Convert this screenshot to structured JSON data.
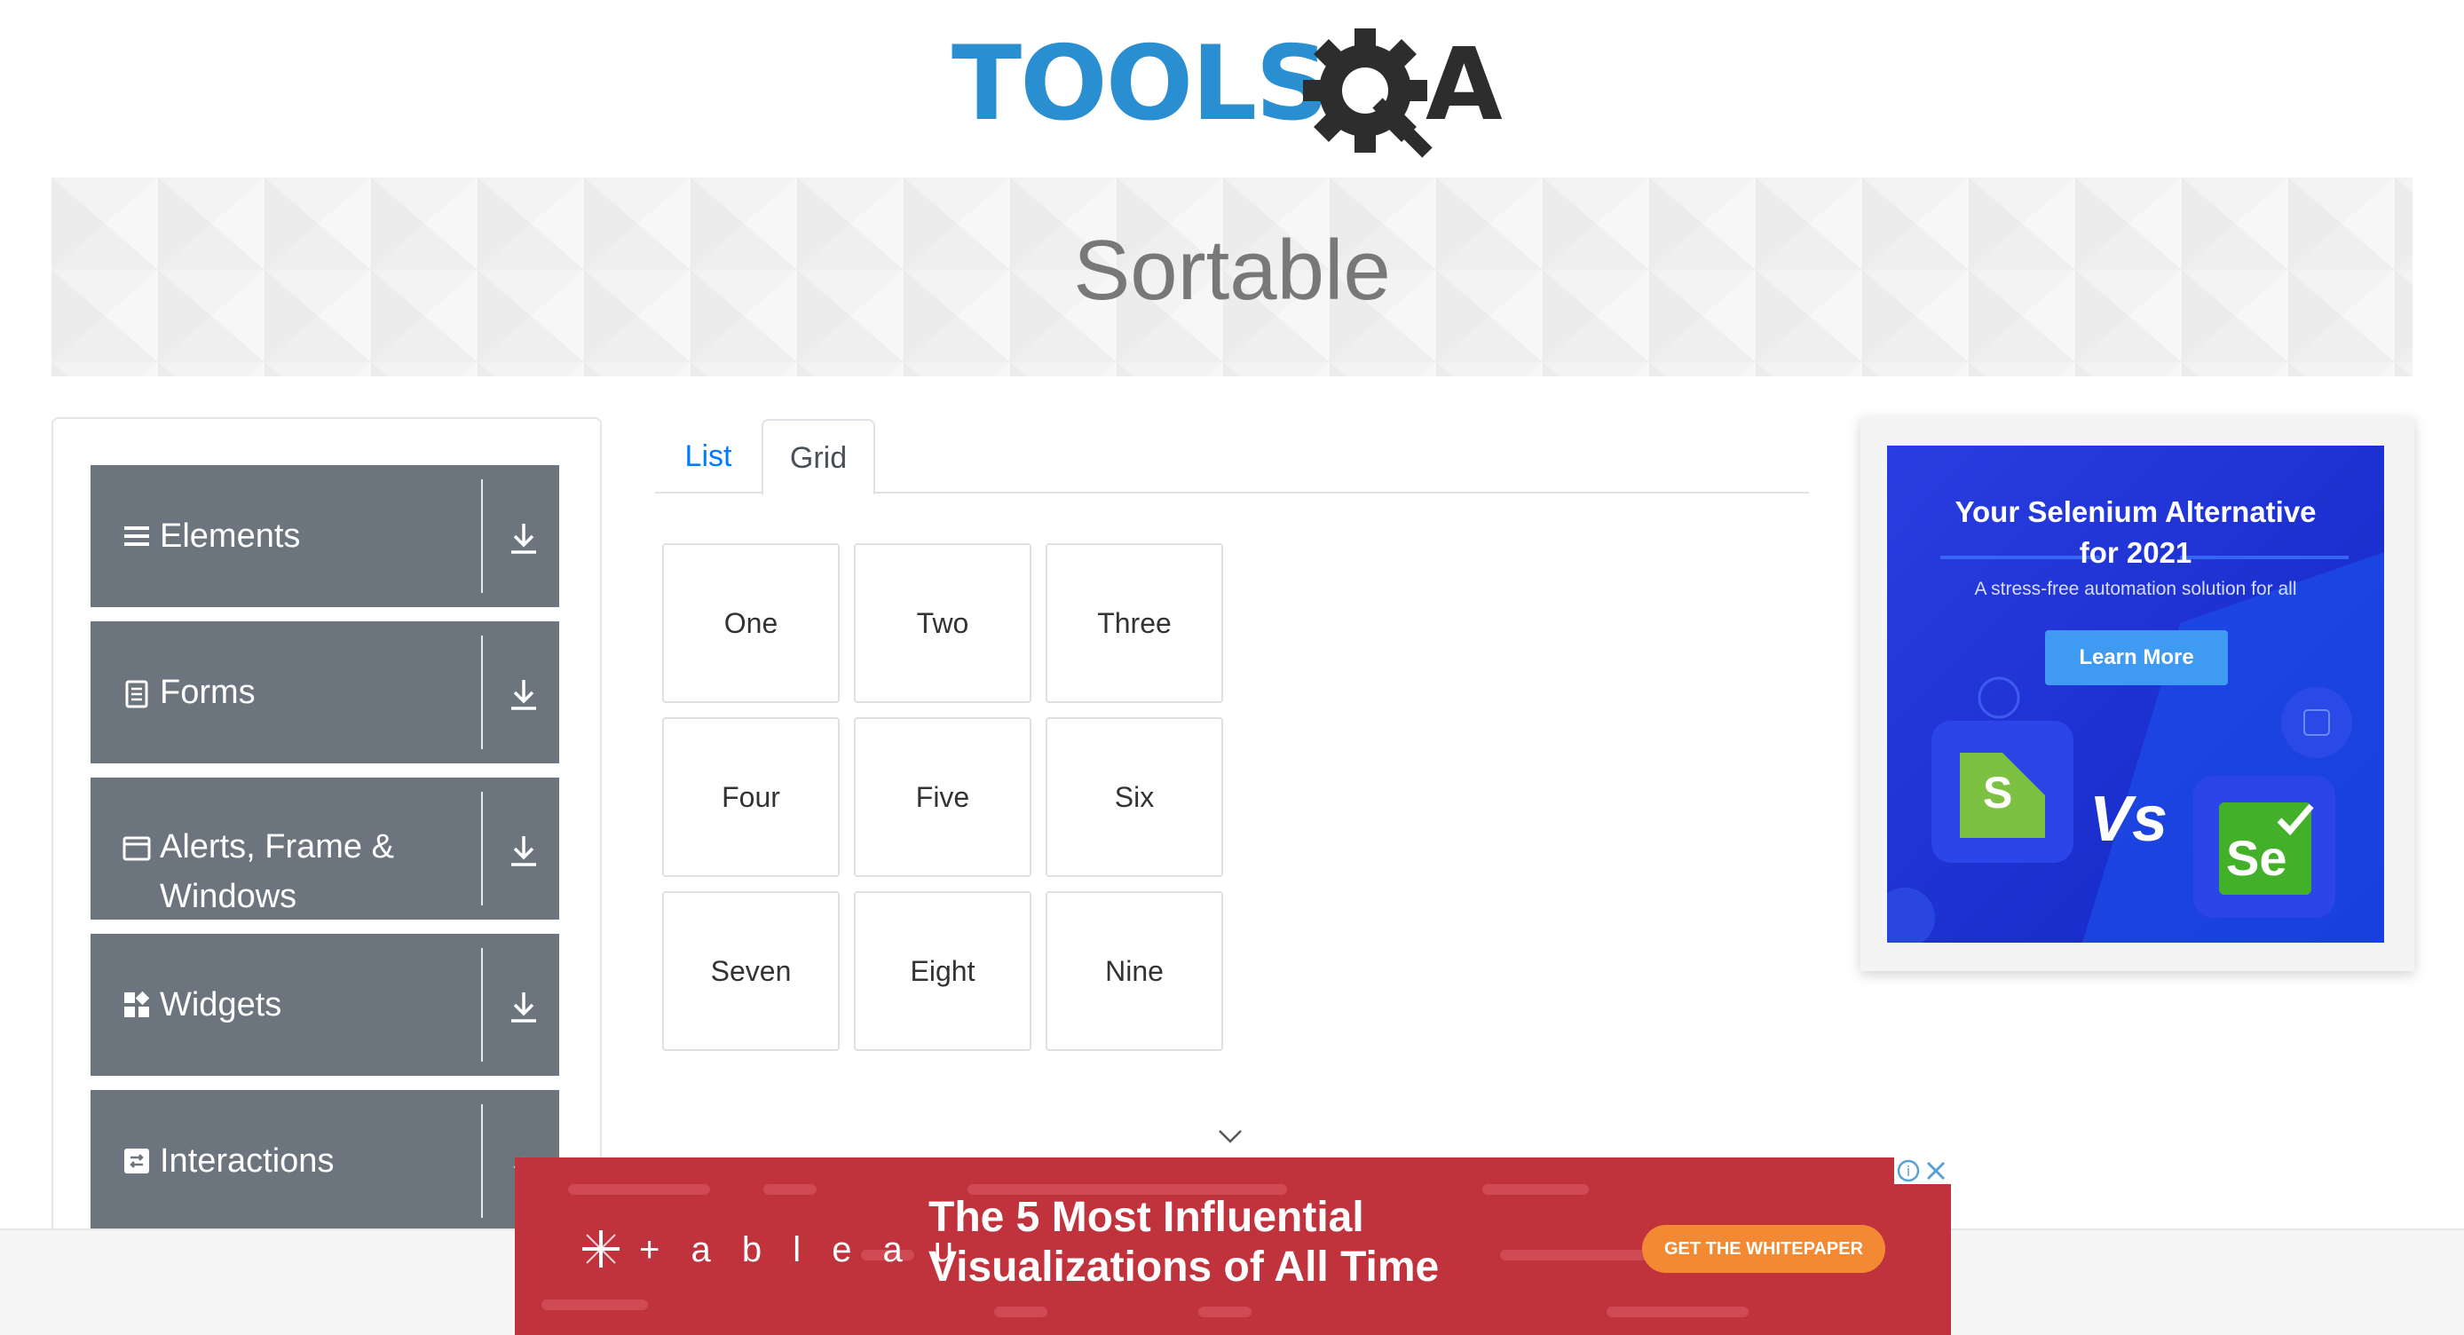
{
  "logo": {
    "text_left": "TOOLS",
    "text_right": "QA",
    "primary_color": "#2a8fd1",
    "dark_color": "#2d2d2d"
  },
  "banner": {
    "title": "Sortable"
  },
  "sidebar": {
    "groups": [
      {
        "label": "Elements",
        "icon": "menu-lines-icon"
      },
      {
        "label": "Forms",
        "icon": "document-icon"
      },
      {
        "label": "Alerts, Frame & Windows",
        "icon": "window-icon"
      },
      {
        "label": "Widgets",
        "icon": "widgets-icon"
      },
      {
        "label": "Interactions",
        "icon": "interactions-icon"
      }
    ]
  },
  "tabs": {
    "list": "List",
    "grid": "Grid",
    "active": "Grid"
  },
  "grid": {
    "items": [
      "One",
      "Two",
      "Three",
      "Four",
      "Five",
      "Six",
      "Seven",
      "Eight",
      "Nine"
    ]
  },
  "ad_right": {
    "headline_1": "Your Selenium Alternative",
    "headline_2": "for 2021",
    "subtitle": "A stress-free automation solution for all",
    "button": "Learn More",
    "vs": "Vs",
    "bg_color": "#1d3ee6"
  },
  "ad_bottom": {
    "brand": "+ a b l e a u",
    "headline_1": "The 5 Most Influential",
    "headline_2": "Visualizations of All Time",
    "cta": "GET THE WHITEPAPER",
    "bg_color": "#c0323c"
  }
}
